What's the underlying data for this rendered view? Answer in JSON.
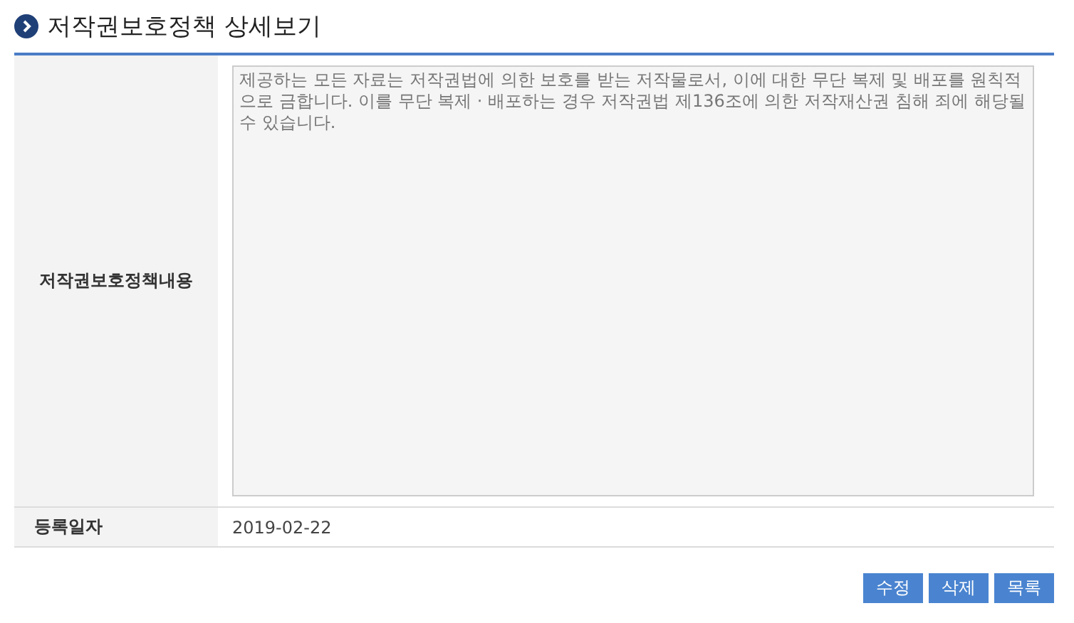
{
  "title": "저작권보호정책 상세보기",
  "rows": [
    {
      "label": "저작권보호정책내용",
      "kind": "textarea",
      "value": "제공하는 모든 자료는 저작권법에 의한 보호를 받는 저작물로서, 이에 대한 무단 복제 및 배포를 원칙적으로 금합니다. 이를 무단 복제 · 배포하는 경우 저작권법 제136조에 의한 저작재산권 침해 죄에 해당될 수 있습니다."
    },
    {
      "label": "등록일자",
      "kind": "text",
      "value": "2019-02-22"
    }
  ],
  "buttons": [
    "수정",
    "삭제",
    "목록"
  ]
}
